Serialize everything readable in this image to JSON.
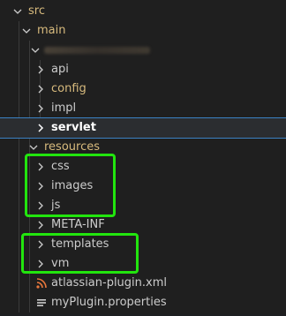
{
  "explorer": {
    "items": [
      {
        "label": "src",
        "type": "folder",
        "expanded": true
      },
      {
        "label": "main",
        "type": "folder",
        "expanded": true
      },
      {
        "label": "",
        "type": "folder",
        "expanded": true,
        "redacted": true
      },
      {
        "label": "api",
        "type": "folder",
        "expanded": false
      },
      {
        "label": "config",
        "type": "folder",
        "expanded": false
      },
      {
        "label": "impl",
        "type": "folder",
        "expanded": false
      },
      {
        "label": "servlet",
        "type": "folder",
        "expanded": false,
        "selected": true
      },
      {
        "label": "resources",
        "type": "folder",
        "expanded": true
      },
      {
        "label": "css",
        "type": "folder",
        "expanded": false
      },
      {
        "label": "images",
        "type": "folder",
        "expanded": false
      },
      {
        "label": "js",
        "type": "folder",
        "expanded": false
      },
      {
        "label": "META-INF",
        "type": "folder",
        "expanded": false
      },
      {
        "label": "templates",
        "type": "folder",
        "expanded": false
      },
      {
        "label": "vm",
        "type": "folder",
        "expanded": false
      },
      {
        "label": "atlassian-plugin.xml",
        "type": "file",
        "icon": "rss-icon"
      },
      {
        "label": "myPlugin.properties",
        "type": "file",
        "icon": "lines-icon"
      }
    ]
  },
  "colors": {
    "background": "#1f1f1f",
    "text": "#cccccc",
    "accent_folder": "#d7ba7d",
    "selection_outline": "#3b82c4",
    "highlight": "#22e50e",
    "xml_icon": "#e8773c"
  }
}
